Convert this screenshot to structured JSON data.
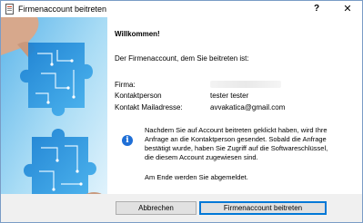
{
  "window": {
    "title": "Firmenaccount beitreten",
    "help_label": "?",
    "close_label": "✕"
  },
  "main": {
    "welcome": "Willkommen!",
    "intro": "Der Firmenaccount, dem Sie beitreten ist:",
    "info": [
      {
        "label": "Firma:",
        "value": ""
      },
      {
        "label": "Kontaktperson",
        "value": "tester tester"
      },
      {
        "label": "Kontakt Mailadresse:",
        "value": "avvakatica@gmail.com"
      }
    ],
    "note_lines": [
      "Nachdem Sie auf Account beitreten geklickt haben, wird Ihre",
      "Anfrage an die Kontaktperson gesendet. Sobald die Anfrage",
      "bestätigt wurde, haben Sie Zugriff auf die Softwareschlüssel,",
      "die diesem Account zugewiesen sind."
    ],
    "logout_note": "Am Ende werden Sie abgemeldet."
  },
  "footer": {
    "cancel_label": "Abbrechen",
    "join_label": "Firmenaccount beitreten"
  },
  "colors": {
    "accent": "#0078d7",
    "info_icon": "#1f6fd6",
    "image_blue": "#2a8fd8"
  }
}
